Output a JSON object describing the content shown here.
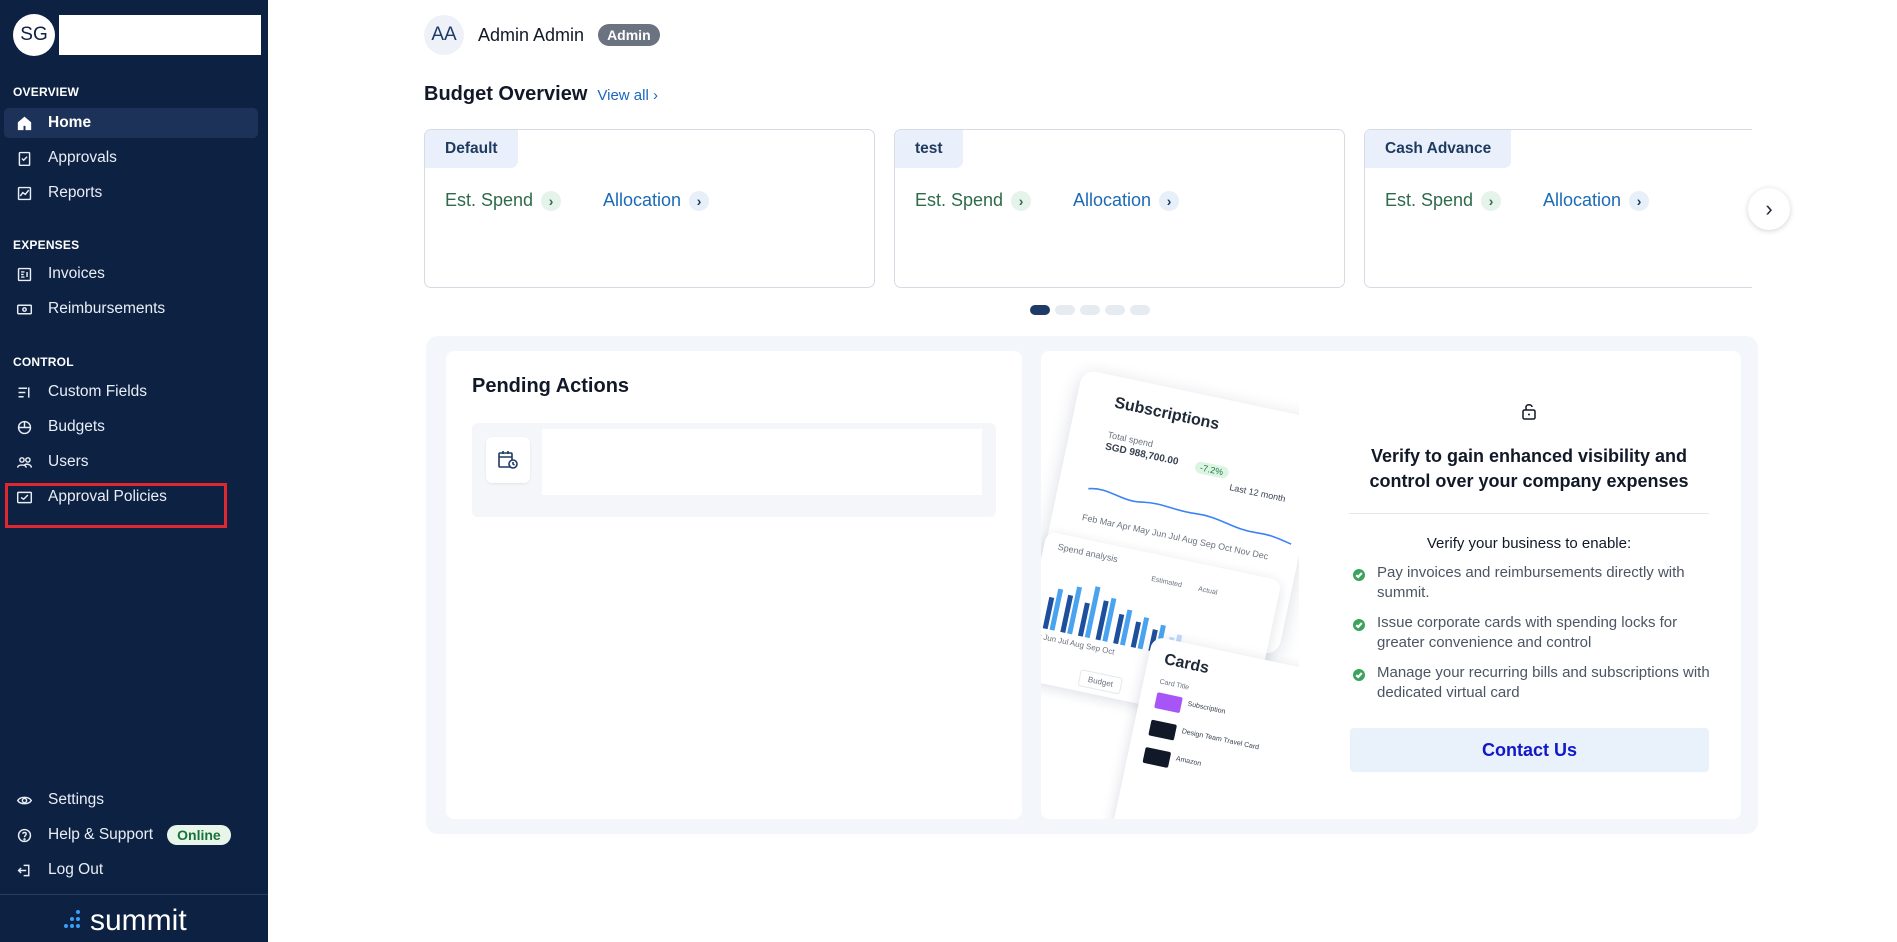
{
  "sidebar": {
    "org_initials": "SG",
    "sections": {
      "overview": "OVERVIEW",
      "expenses": "EXPENSES",
      "control": "CONTROL"
    },
    "items": {
      "home": "Home",
      "approvals": "Approvals",
      "reports": "Reports",
      "invoices": "Invoices",
      "reimbursements": "Reimbursements",
      "custom_fields": "Custom Fields",
      "budgets": "Budgets",
      "users": "Users",
      "approval_policies": "Approval Policies",
      "settings": "Settings",
      "help_support": "Help & Support",
      "log_out": "Log Out"
    },
    "online_badge": "Online",
    "brand": "summit",
    "active_item": "Home",
    "highlighted_item": "Approval Policies",
    "colors": {
      "background": "#0d2143",
      "active": "#1c3259",
      "highlight_border": "#e0262f"
    }
  },
  "user": {
    "initials": "AA",
    "name": "Admin Admin",
    "role": "Admin"
  },
  "budget_overview": {
    "title": "Budget Overview",
    "view_all": "View all",
    "cards": [
      {
        "name": "Default",
        "est_spend": "Est. Spend",
        "allocation": "Allocation"
      },
      {
        "name": "test",
        "est_spend": "Est. Spend",
        "allocation": "Allocation"
      },
      {
        "name": "Cash Advance",
        "est_spend": "Est. Spend",
        "allocation": "Allocation"
      }
    ],
    "carousel_pages": 5,
    "current_page": 1
  },
  "pending_actions": {
    "title": "Pending Actions"
  },
  "verify": {
    "headline": "Verify to gain enhanced visibility and control over your company expenses",
    "subheading": "Verify your business to enable:",
    "benefits": [
      "Pay invoices and reimbursements directly with summit.",
      "Issue corporate cards with spending locks for greater convenience and control",
      "Manage your recurring bills and subscriptions with dedicated virtual card"
    ],
    "contact_button": "Contact Us",
    "mockup": {
      "subscriptions_title": "Subscriptions",
      "total_spend_label": "Total spend",
      "total_spend_value": "SGD 988,700.00",
      "change": "-7.2%",
      "period": "Last 12 month",
      "months": "Feb Mar Apr May Jun Jul Aug Sep Oct Nov Dec",
      "spend_analysis": "Spend analysis",
      "estimated": "Estimated",
      "actual": "Actual",
      "months2": "ay Jun Jul Aug Sep Oct",
      "budget_label": "Budget",
      "cards_title": "Cards",
      "card_title_col": "Card Title",
      "card_1": "Subscription",
      "card_2": "Design Team Travel Card",
      "card_3": "Amazon"
    }
  }
}
